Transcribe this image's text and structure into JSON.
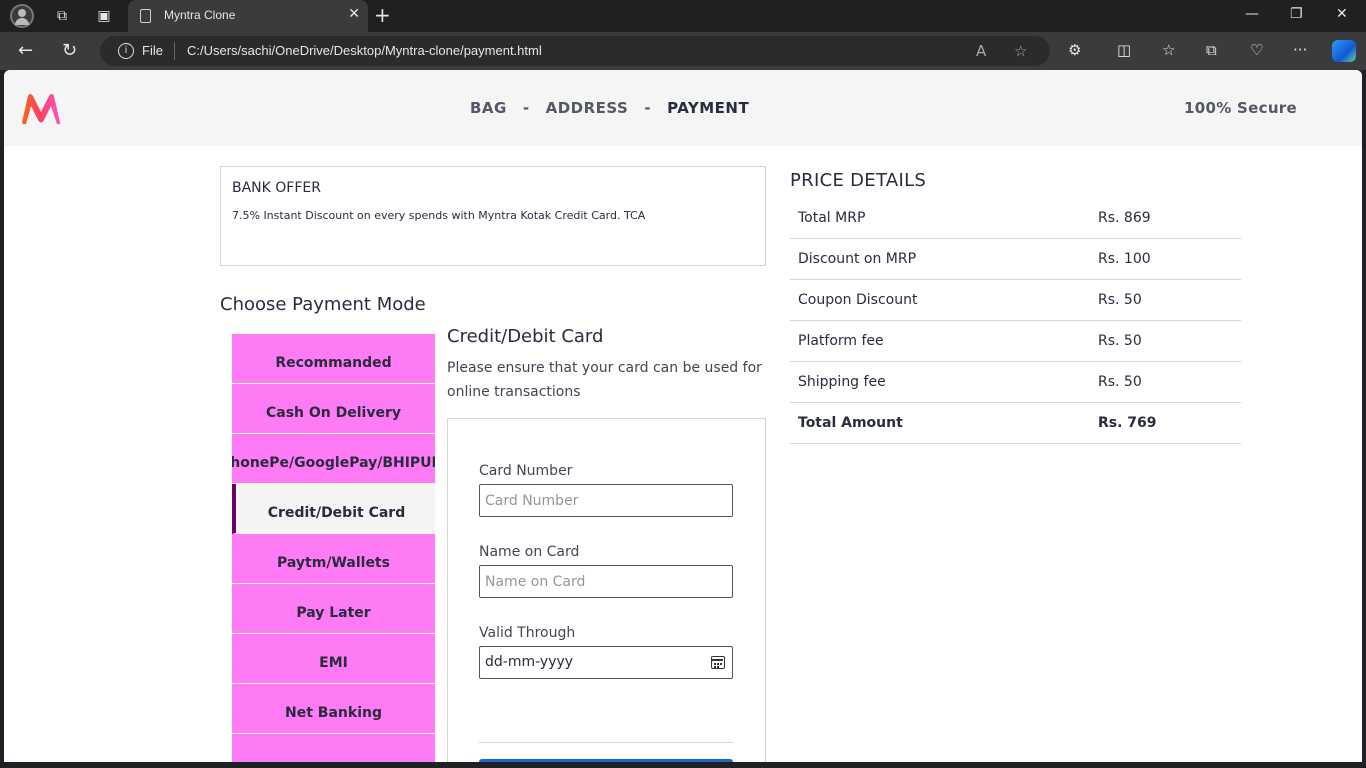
{
  "browser": {
    "tab_title": "Myntra Clone",
    "file_label": "File",
    "url": "C:/Users/sachi/OneDrive/Desktop/Myntra-clone/payment.html"
  },
  "header": {
    "steps": [
      "BAG",
      "ADDRESS",
      "PAYMENT"
    ],
    "separator": "-",
    "secure": "100% Secure",
    "logo_colors": [
      "#ff3f6c",
      "#fb56c1",
      "#f26a10"
    ]
  },
  "offer": {
    "title": "BANK OFFER",
    "text": "7.5% Instant Discount on every spends with Myntra Kotak Credit Card. TCA"
  },
  "payment": {
    "heading": "Choose Payment Mode",
    "modes": [
      "Recommanded",
      "Cash On Delivery",
      "PhonePe/GooglePay/BHIPUPI",
      "Credit/Debit Card",
      "Paytm/Wallets",
      "Pay Later",
      "EMI",
      "Net Banking",
      ""
    ],
    "active_mode": "Credit/Debit Card",
    "mode_color": "#ff7bf5",
    "card": {
      "title": "Credit/Debit Card",
      "description": "Please ensure that your card can be used for online transactions",
      "card_number_label": "Card Number",
      "card_number_placeholder": "Card Number",
      "name_label": "Name on Card",
      "name_placeholder": "Name on Card",
      "valid_label": "Valid Through",
      "valid_placeholder": "dd-mm-yyyy",
      "button_color": "#1f68c6"
    }
  },
  "price": {
    "title": "PRICE DETAILS",
    "rows": [
      {
        "label": "Total MRP",
        "value": "Rs. 869"
      },
      {
        "label": "Discount on MRP",
        "value": "Rs. 100"
      },
      {
        "label": "Coupon Discount",
        "value": "Rs. 50"
      },
      {
        "label": "Platform fee",
        "value": "Rs. 50"
      },
      {
        "label": "Shipping fee",
        "value": "Rs. 50"
      },
      {
        "label": "Total Amount",
        "value": "Rs. 769"
      }
    ]
  }
}
